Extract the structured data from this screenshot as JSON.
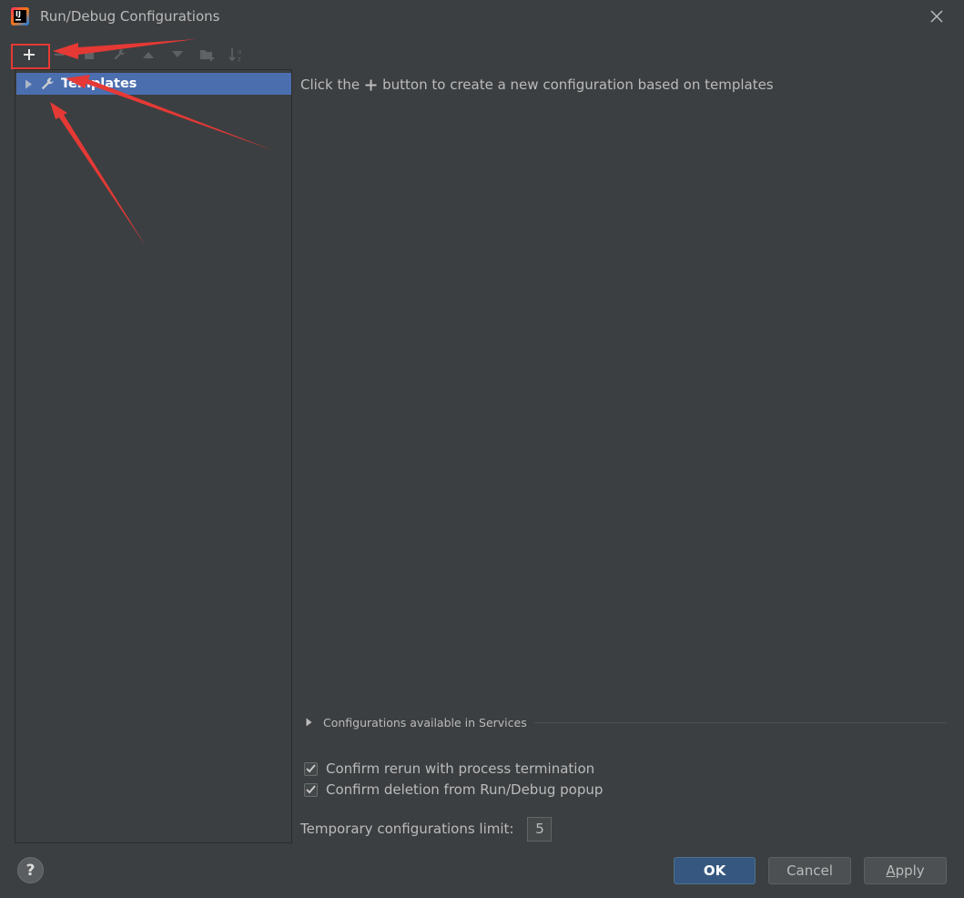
{
  "window": {
    "title": "Run/Debug Configurations",
    "app_icon_text": "IJ"
  },
  "toolbar": {
    "buttons": [
      {
        "icon": "plus-icon"
      },
      {
        "icon": "minus-icon"
      },
      {
        "icon": "copy-icon"
      },
      {
        "icon": "wrench-icon"
      },
      {
        "icon": "arrow-up-icon"
      },
      {
        "icon": "arrow-down-icon"
      },
      {
        "icon": "new-folder-icon"
      },
      {
        "icon": "sort-alpha-icon"
      }
    ]
  },
  "tree": {
    "items": [
      {
        "label": "Templates",
        "icon": "wrench-icon",
        "selected": true,
        "expanded": false
      }
    ]
  },
  "main": {
    "hint_prefix": "Click the",
    "hint_suffix": "button to create a new configuration based on templates",
    "services_label": "Configurations available in Services",
    "checkboxes": [
      {
        "label": "Confirm rerun with process termination",
        "checked": true
      },
      {
        "label": "Confirm deletion from Run/Debug popup",
        "checked": true
      }
    ],
    "limit_label": "Temporary configurations limit:",
    "limit_value": "5"
  },
  "footer": {
    "help_label": "?",
    "ok_label": "OK",
    "cancel_label": "Cancel",
    "apply_first": "A",
    "apply_rest": "pply"
  },
  "colors": {
    "background": "#3c3f41",
    "selection": "#4b6eaf",
    "primary_button": "#365880",
    "annotation_red": "#e53935"
  }
}
